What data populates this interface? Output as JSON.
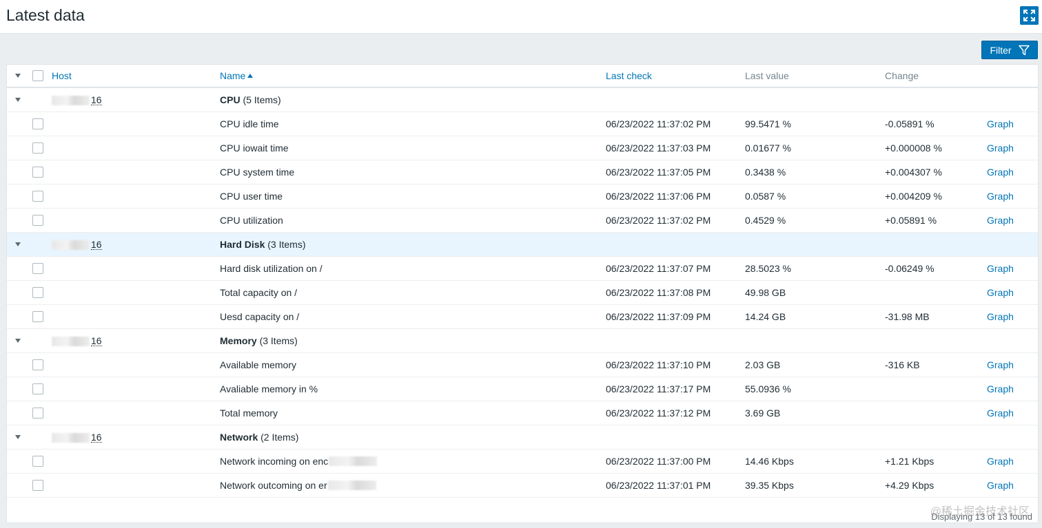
{
  "page": {
    "title": "Latest data",
    "filter_label": "Filter",
    "footer_status": "Displaying 13 of 13 found",
    "watermark": "@稀土掘金技术社区"
  },
  "columns": {
    "host": "Host",
    "name": "Name",
    "last_check": "Last check",
    "last_value": "Last value",
    "change": "Change"
  },
  "groups": [
    {
      "host_suffix": "16",
      "name": "CPU",
      "count_label": "(5 Items)",
      "items": [
        {
          "name": "CPU idle time",
          "last_check": "06/23/2022 11:37:02 PM",
          "last_value": "99.5471 %",
          "change": "-0.05891 %",
          "graph": "Graph"
        },
        {
          "name": "CPU iowait time",
          "last_check": "06/23/2022 11:37:03 PM",
          "last_value": "0.01677 %",
          "change": "+0.000008 %",
          "graph": "Graph"
        },
        {
          "name": "CPU system time",
          "last_check": "06/23/2022 11:37:05 PM",
          "last_value": "0.3438 %",
          "change": "+0.004307 %",
          "graph": "Graph"
        },
        {
          "name": "CPU user time",
          "last_check": "06/23/2022 11:37:06 PM",
          "last_value": "0.0587 %",
          "change": "+0.004209 %",
          "graph": "Graph"
        },
        {
          "name": "CPU utilization",
          "last_check": "06/23/2022 11:37:02 PM",
          "last_value": "0.4529 %",
          "change": "+0.05891 %",
          "graph": "Graph"
        }
      ]
    },
    {
      "host_suffix": "16",
      "name": "Hard Disk",
      "count_label": "(3 Items)",
      "highlight": true,
      "items": [
        {
          "name": "Hard disk utilization on /",
          "last_check": "06/23/2022 11:37:07 PM",
          "last_value": "28.5023 %",
          "change": "-0.06249 %",
          "graph": "Graph"
        },
        {
          "name": "Total capacity on /",
          "last_check": "06/23/2022 11:37:08 PM",
          "last_value": "49.98 GB",
          "change": "",
          "graph": "Graph"
        },
        {
          "name": "Uesd capacity on /",
          "last_check": "06/23/2022 11:37:09 PM",
          "last_value": "14.24 GB",
          "change": "-31.98 MB",
          "graph": "Graph"
        }
      ]
    },
    {
      "host_suffix": "16",
      "name": "Memory",
      "count_label": "(3 Items)",
      "items": [
        {
          "name": "Available memory",
          "last_check": "06/23/2022 11:37:10 PM",
          "last_value": "2.03 GB",
          "change": "-316 KB",
          "graph": "Graph"
        },
        {
          "name": "Avaliable memory in %",
          "last_check": "06/23/2022 11:37:17 PM",
          "last_value": "55.0936 %",
          "change": "",
          "graph": "Graph"
        },
        {
          "name": "Total memory",
          "last_check": "06/23/2022 11:37:12 PM",
          "last_value": "3.69 GB",
          "change": "",
          "graph": "Graph"
        }
      ]
    },
    {
      "host_suffix": "16",
      "name": "Network",
      "count_label": "(2 Items)",
      "items": [
        {
          "name": "Network incoming on enc",
          "redacted": true,
          "last_check": "06/23/2022 11:37:00 PM",
          "last_value": "14.46 Kbps",
          "change": "+1.21 Kbps",
          "graph": "Graph"
        },
        {
          "name": "Network outcoming on er",
          "redacted": true,
          "last_check": "06/23/2022 11:37:01 PM",
          "last_value": "39.35 Kbps",
          "change": "+4.29 Kbps",
          "graph": "Graph"
        }
      ]
    }
  ]
}
